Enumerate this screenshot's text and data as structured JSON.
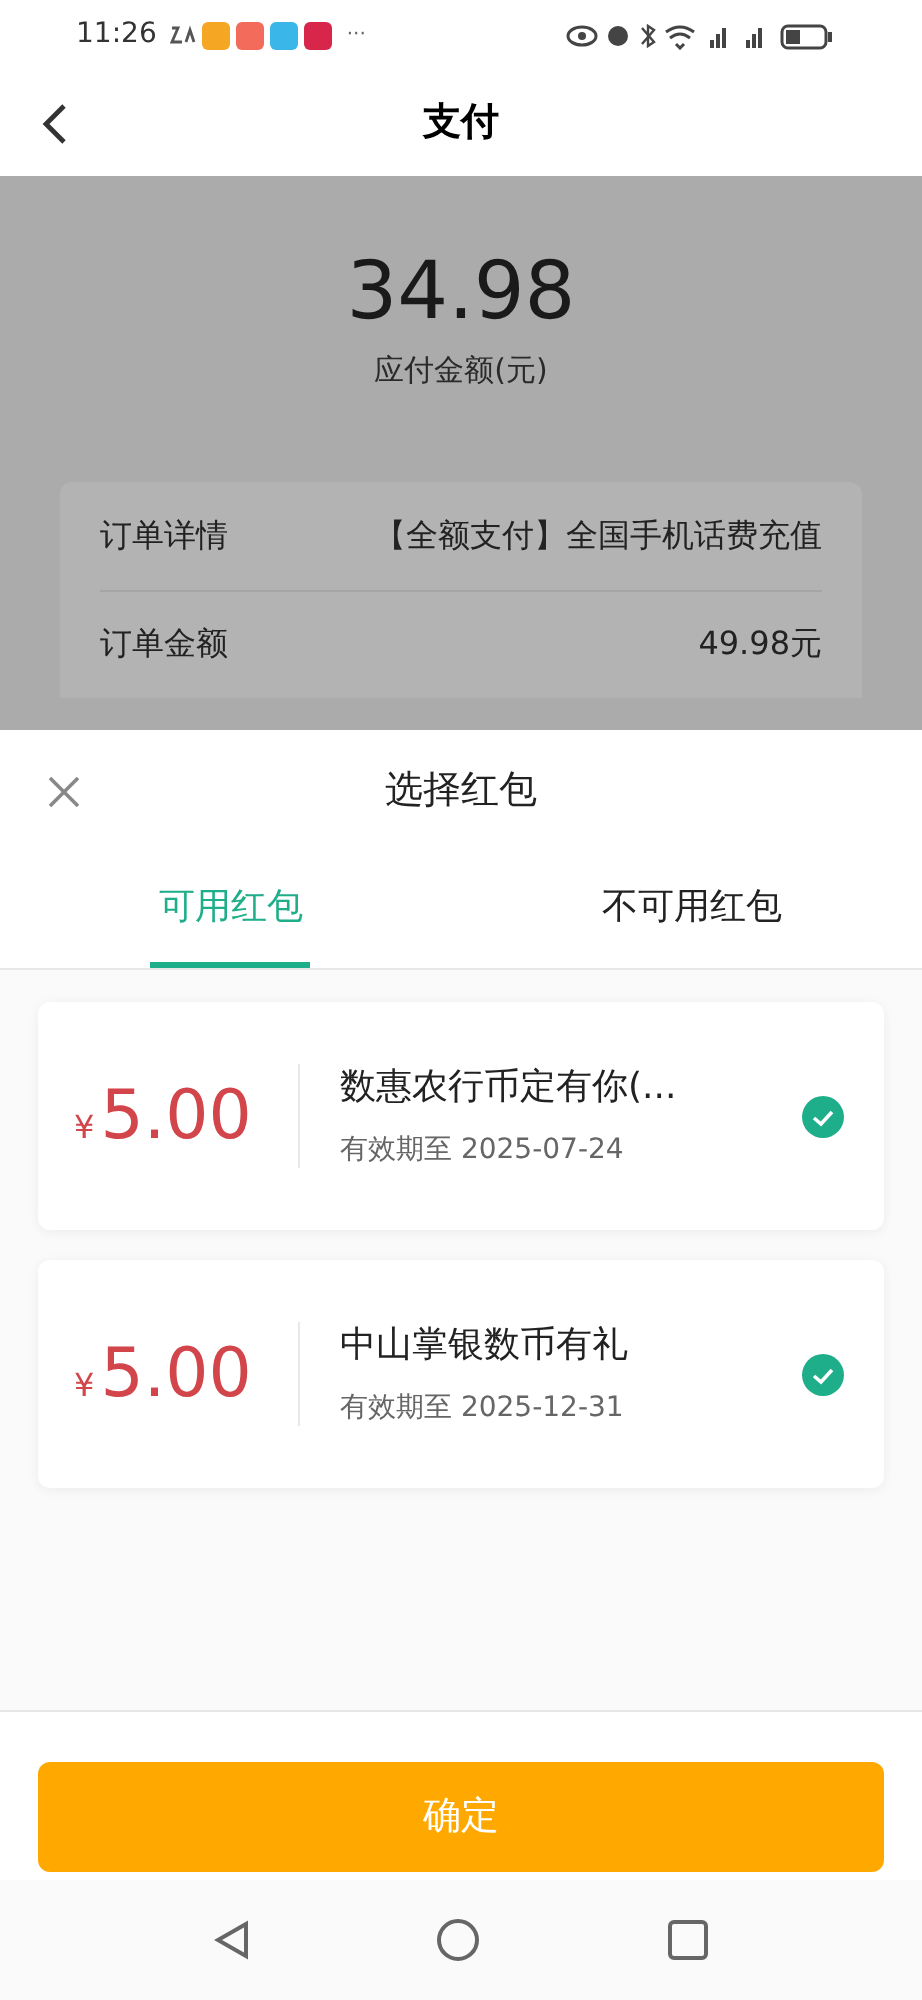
{
  "status_bar": {
    "time": "11:26",
    "more": "···"
  },
  "header": {
    "title": "支付"
  },
  "payment": {
    "amount": "34.98",
    "label": "应付金额(元)"
  },
  "order": [
    {
      "label": "订单详情",
      "value": "【全额支付】全国手机话费充值"
    },
    {
      "label": "订单金额",
      "value": "49.98元"
    }
  ],
  "sheet": {
    "title": "选择红包",
    "tabs": [
      {
        "label": "可用红包",
        "selected": true
      },
      {
        "label": "不可用红包",
        "selected": false
      }
    ],
    "coupons": [
      {
        "currency": "¥",
        "amount": "5.00",
        "title": "数惠农行币定有你(...",
        "expiry": "有效期至 2025-07-24",
        "checked": true
      },
      {
        "currency": "¥",
        "amount": "5.00",
        "title": "中山掌银数币有礼",
        "expiry": "有效期至 2025-12-31",
        "checked": true
      }
    ],
    "confirm": "确定"
  }
}
